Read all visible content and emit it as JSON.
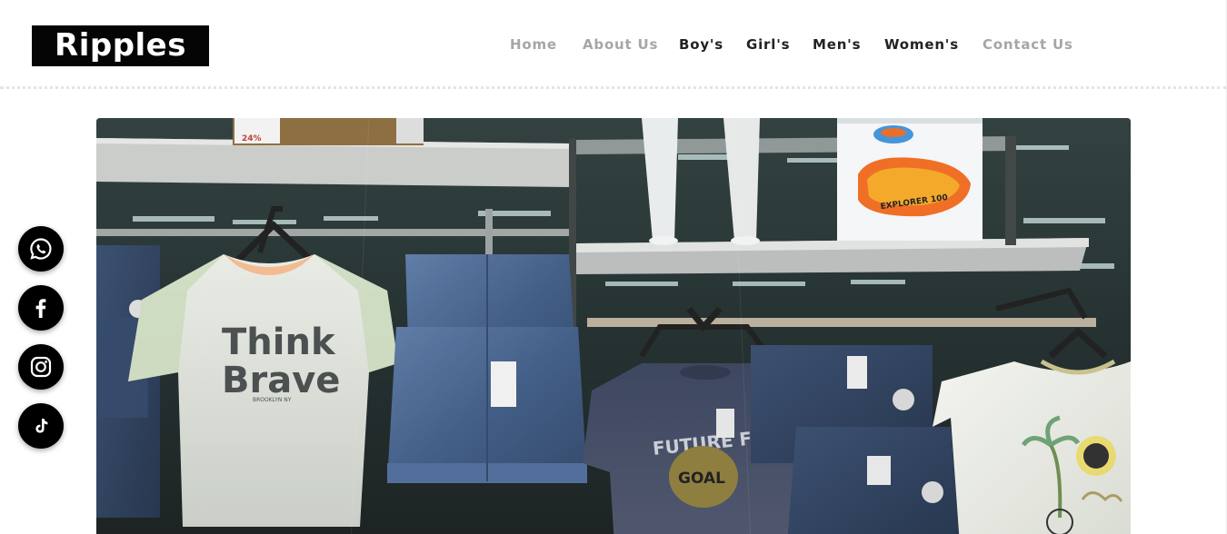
{
  "brand": {
    "logo_text": "Ripples"
  },
  "nav": {
    "items": [
      {
        "label": "Home",
        "state": "muted"
      },
      {
        "label": "About Us",
        "state": "muted"
      },
      {
        "label": "Boy's",
        "state": "active"
      },
      {
        "label": "Girl's",
        "state": "active"
      },
      {
        "label": "Men's",
        "state": "active"
      },
      {
        "label": "Women's",
        "state": "active"
      },
      {
        "label": "Contact Us",
        "state": "muted"
      }
    ]
  },
  "hero": {
    "shirt_text_line1": "Think",
    "shirt_text_line2": "Brave",
    "shirt_text_small": "BROOKLYN NY",
    "shirt2_text": "FUTURE FOOTB",
    "shirt2_badge": "GOAL",
    "boat_label": "EXPLORER 100",
    "sign_text": "24%"
  },
  "social": [
    {
      "name": "whatsapp-icon"
    },
    {
      "name": "facebook-icon"
    },
    {
      "name": "instagram-icon"
    },
    {
      "name": "tiktok-icon"
    }
  ],
  "colors": {
    "logo_bg": "#050505",
    "nav_muted": "#a6a6a6",
    "nav_active": "#222222",
    "social_bg": "#000000"
  }
}
